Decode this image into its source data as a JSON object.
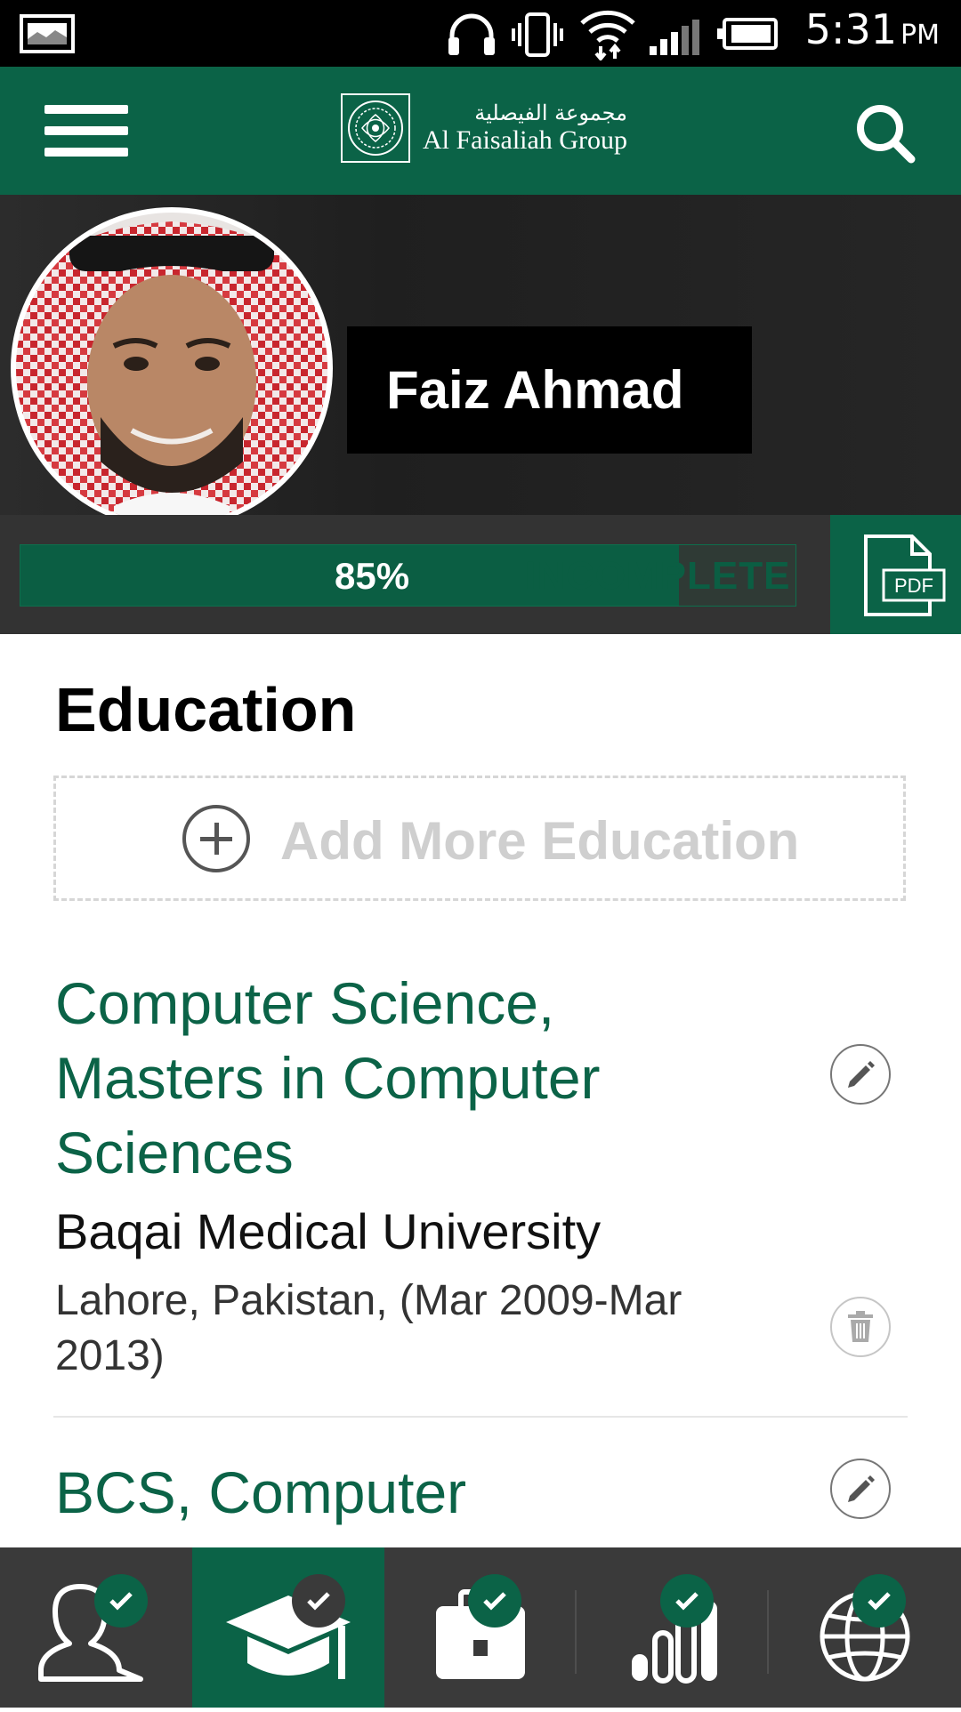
{
  "status_bar": {
    "time": "5:31",
    "ampm": "PM",
    "icons": [
      "gallery-icon",
      "headphones-icon",
      "vibrate-icon",
      "wifi-icon",
      "signal-icon",
      "battery-icon"
    ]
  },
  "app_bar": {
    "logo_arabic": "مجموعة الفيصلية",
    "logo_english": "Al Faisaliah Group",
    "icons": [
      "menu-icon",
      "search-icon"
    ]
  },
  "profile": {
    "name": "Faiz Ahmad"
  },
  "progress": {
    "percent_label": "85%",
    "percent_value": 0.85,
    "status": "INCOMPLETE"
  },
  "pdf_button": {
    "label": "PDF"
  },
  "education": {
    "title": "Education",
    "add_label": "Add More Education",
    "entries": [
      {
        "degree_line1": "Computer Science,",
        "degree_line2": "Masters in Computer",
        "degree_line3": "Sciences",
        "school": "Baqai Medical University",
        "meta": "Lahore, Pakistan, (Mar 2009-Mar 2013)"
      },
      {
        "degree_line1": "BCS, Computer"
      }
    ]
  },
  "bottom_nav": {
    "tabs": [
      "profile-tab",
      "education-tab",
      "experience-tab",
      "skills-tab",
      "languages-tab"
    ],
    "active_tab": "education-tab"
  },
  "colors": {
    "brand_green": "#0b6347",
    "dark_bar": "#333333",
    "nav_bg": "#3a3a3a"
  }
}
